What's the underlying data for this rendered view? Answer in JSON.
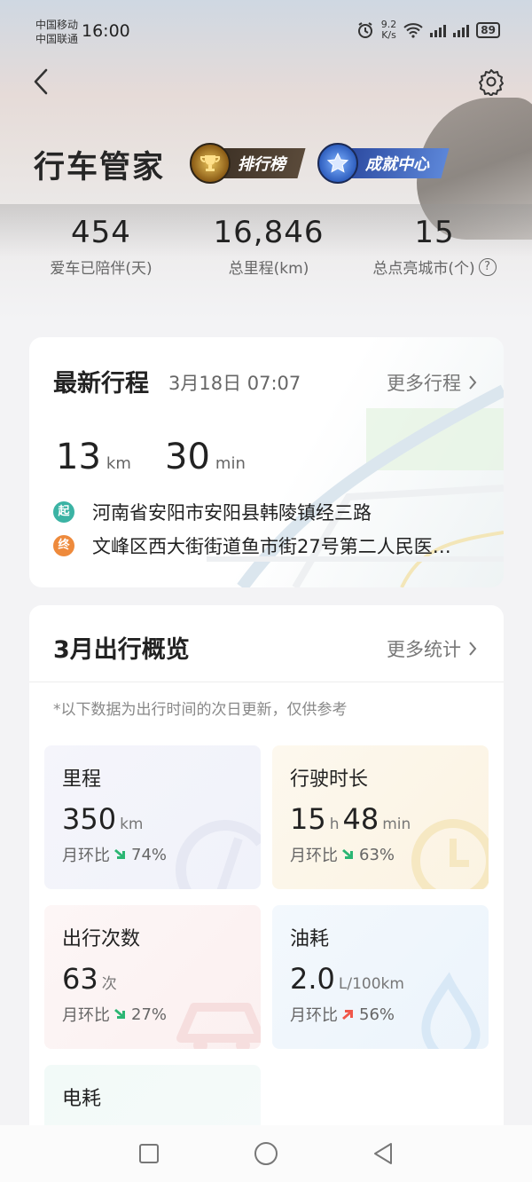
{
  "status_bar": {
    "carrier1": "中国移动",
    "carrier2": "中国联通",
    "time": "16:00",
    "net_speed": "9.2",
    "net_unit": "K/s",
    "battery": "89"
  },
  "header": {
    "back_icon": "chevron-left-icon",
    "settings_icon": "gear-icon",
    "title": "行车管家",
    "rank_badge": "排行榜",
    "achievement_badge": "成就中心"
  },
  "stats": [
    {
      "value": "454",
      "label": "爱车已陪伴(天)"
    },
    {
      "value": "16,846",
      "label": "总里程(km)"
    },
    {
      "value": "15",
      "label": "总点亮城市(个)"
    }
  ],
  "latest_trip": {
    "title": "最新行程",
    "date": "3月18日 07:07",
    "more": "更多行程",
    "distance": "13",
    "distance_unit": "km",
    "duration": "30",
    "duration_unit": "min",
    "start_tag": "起",
    "start": "河南省安阳市安阳县韩陵镇经三路",
    "end_tag": "终",
    "end": "文峰区西大街街道鱼市街27号第二人民医…"
  },
  "overview": {
    "title": "3月出行概览",
    "more": "更多统计",
    "note": "*以下数据为出行时间的次日更新，仅供参考",
    "tiles": {
      "mileage": {
        "title": "里程",
        "value": "350",
        "unit": "km",
        "cmp_label": "月环比",
        "cmp_dir": "down",
        "cmp_value": "74%"
      },
      "drive_time": {
        "title": "行驶时长",
        "hours": "15",
        "h_unit": "h",
        "minutes": "48",
        "m_unit": "min",
        "cmp_label": "月环比",
        "cmp_dir": "down",
        "cmp_value": "63%"
      },
      "trips": {
        "title": "出行次数",
        "value": "63",
        "unit": "次",
        "cmp_label": "月环比",
        "cmp_dir": "down",
        "cmp_value": "27%"
      },
      "fuel": {
        "title": "油耗",
        "value": "2.0",
        "unit": "L/100km",
        "cmp_label": "月环比",
        "cmp_dir": "up",
        "cmp_value": "56%"
      },
      "electric": {
        "title": "电耗"
      }
    },
    "colors": {
      "down": "#2bb673",
      "up": "#f0584b"
    }
  },
  "nav": {
    "square": "recent-apps-icon",
    "circle": "home-icon",
    "triangle": "back-icon"
  }
}
